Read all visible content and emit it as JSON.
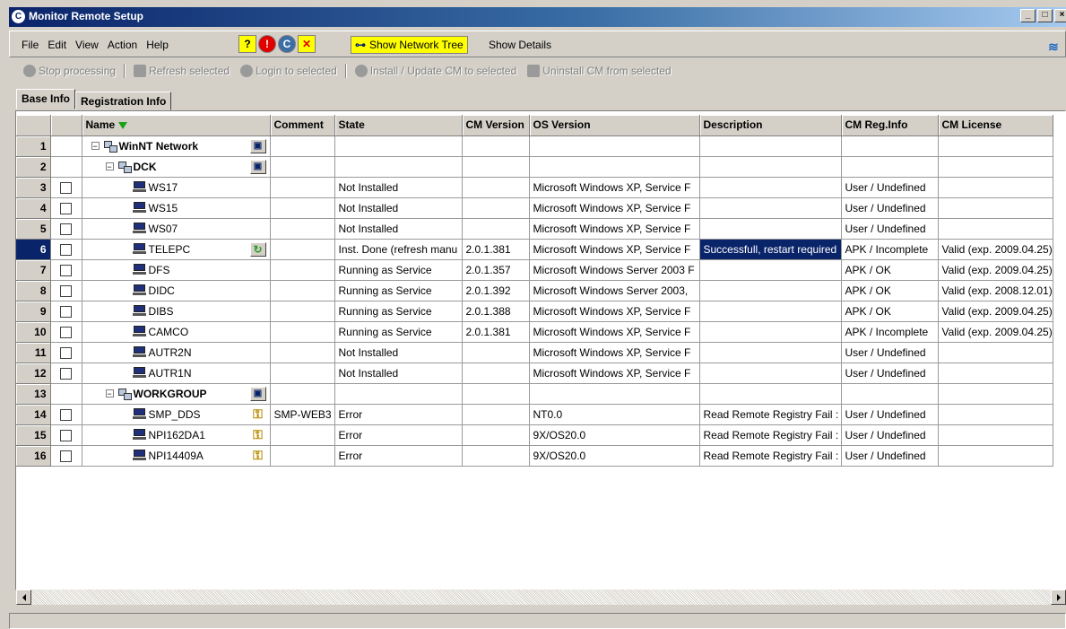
{
  "window": {
    "title": "Monitor Remote Setup",
    "app_icon_letter": "C",
    "controls": [
      "_",
      "□",
      "×"
    ]
  },
  "menu": {
    "items": [
      "File",
      "Edit",
      "View",
      "Action",
      "Help"
    ],
    "icon_buttons": [
      {
        "name": "help-icon",
        "glyph": "?"
      },
      {
        "name": "alert-icon",
        "glyph": "!"
      },
      {
        "name": "cm-icon",
        "glyph": "C"
      },
      {
        "name": "disconnect-icon",
        "glyph": "✕"
      }
    ],
    "show_network_tree": "Show Network Tree",
    "show_details": "Show Details"
  },
  "actions": [
    {
      "name": "stop-processing",
      "label": "Stop processing"
    },
    {
      "name": "refresh-selected",
      "label": "Refresh selected"
    },
    {
      "name": "login-to-selected",
      "label": "Login to selected"
    },
    {
      "name": "install-update-cm",
      "label": "Install / Update CM to selected"
    },
    {
      "name": "uninstall-cm",
      "label": "Uninstall CM from selected"
    }
  ],
  "tabs": [
    {
      "label": "Base Info",
      "active": true
    },
    {
      "label": "Registration Info",
      "active": false
    }
  ],
  "columns": {
    "name": "Name",
    "comment": "Comment",
    "state": "State",
    "cm_version": "CM Version",
    "os_version": "OS Version",
    "description": "Description",
    "cm_reg_info": "CM Reg.Info",
    "cm_license": "CM License"
  },
  "rows": [
    {
      "num": "1",
      "level": 0,
      "type": "network",
      "name": "WinNT Network",
      "bold": true,
      "check": false,
      "side": "monitor",
      "comment": "",
      "state": "",
      "cm_version": "",
      "os_version": "",
      "description": "",
      "cm_reg_info": "",
      "cm_license": ""
    },
    {
      "num": "2",
      "level": 1,
      "type": "network",
      "name": "DCK",
      "bold": true,
      "check": false,
      "side": "monitor",
      "comment": "",
      "state": "",
      "cm_version": "",
      "os_version": "",
      "description": "",
      "cm_reg_info": "",
      "cm_license": ""
    },
    {
      "num": "3",
      "level": 2,
      "type": "pc",
      "name": "WS17",
      "check": true,
      "side": "",
      "comment": "",
      "state": "Not Installed",
      "cm_version": "",
      "os_version": "Microsoft Windows XP, Service F",
      "description": "",
      "cm_reg_info": "User / Undefined",
      "cm_license": ""
    },
    {
      "num": "4",
      "level": 2,
      "type": "pc",
      "name": "WS15",
      "check": true,
      "side": "",
      "comment": "",
      "state": "Not Installed",
      "cm_version": "",
      "os_version": "Microsoft Windows XP, Service F",
      "description": "",
      "cm_reg_info": "User / Undefined",
      "cm_license": ""
    },
    {
      "num": "5",
      "level": 2,
      "type": "pc",
      "name": "WS07",
      "check": true,
      "side": "",
      "comment": "",
      "state": "Not Installed",
      "cm_version": "",
      "os_version": "Microsoft Windows XP, Service F",
      "description": "",
      "cm_reg_info": "User / Undefined",
      "cm_license": ""
    },
    {
      "num": "6",
      "level": 2,
      "type": "pc",
      "name": "TELEPC",
      "check": true,
      "side": "refresh",
      "selected": true,
      "comment": "",
      "state": "Inst. Done (refresh manu",
      "cm_version": "2.0.1.381",
      "os_version": "Microsoft Windows XP, Service F",
      "description": "Successfull, restart required",
      "desc_highlight": true,
      "cm_reg_info": "APK / Incomplete",
      "cm_license": "Valid (exp. 2009.04.25)"
    },
    {
      "num": "7",
      "level": 2,
      "type": "pc",
      "name": "DFS",
      "check": true,
      "side": "",
      "comment": "",
      "state": "Running as Service",
      "cm_version": "2.0.1.357",
      "os_version": "Microsoft Windows Server 2003 F",
      "description": "",
      "cm_reg_info": "APK / OK",
      "cm_license": "Valid (exp. 2009.04.25)"
    },
    {
      "num": "8",
      "level": 2,
      "type": "pc",
      "name": "DIDC",
      "check": true,
      "side": "",
      "comment": "",
      "state": "Running as Service",
      "cm_version": "2.0.1.392",
      "os_version": "Microsoft Windows Server 2003,",
      "description": "",
      "cm_reg_info": "APK / OK",
      "cm_license": "Valid (exp. 2008.12.01)"
    },
    {
      "num": "9",
      "level": 2,
      "type": "pc",
      "name": "DIBS",
      "check": true,
      "side": "",
      "comment": "",
      "state": "Running as Service",
      "cm_version": "2.0.1.388",
      "os_version": "Microsoft Windows XP, Service F",
      "description": "",
      "cm_reg_info": "APK / OK",
      "cm_license": "Valid (exp. 2009.04.25)"
    },
    {
      "num": "10",
      "level": 2,
      "type": "pc",
      "name": "CAMCO",
      "check": true,
      "side": "",
      "comment": "",
      "state": "Running as Service",
      "cm_version": "2.0.1.381",
      "os_version": "Microsoft Windows XP, Service F",
      "description": "",
      "cm_reg_info": "APK / Incomplete",
      "cm_license": "Valid (exp. 2009.04.25)"
    },
    {
      "num": "11",
      "level": 2,
      "type": "pc",
      "name": "AUTR2N",
      "check": true,
      "side": "",
      "comment": "",
      "state": "Not Installed",
      "cm_version": "",
      "os_version": "Microsoft Windows XP, Service F",
      "description": "",
      "cm_reg_info": "User / Undefined",
      "cm_license": ""
    },
    {
      "num": "12",
      "level": 2,
      "type": "pc",
      "name": "AUTR1N",
      "check": true,
      "side": "",
      "comment": "",
      "state": "Not Installed",
      "cm_version": "",
      "os_version": "Microsoft Windows XP, Service F",
      "description": "",
      "cm_reg_info": "User / Undefined",
      "cm_license": ""
    },
    {
      "num": "13",
      "level": 1,
      "type": "network",
      "name": "WORKGROUP",
      "bold": true,
      "check": false,
      "side": "monitor",
      "comment": "",
      "state": "",
      "cm_version": "",
      "os_version": "",
      "description": "",
      "cm_reg_info": "",
      "cm_license": ""
    },
    {
      "num": "14",
      "level": 2,
      "type": "pc",
      "name": "SMP_DDS",
      "check": true,
      "side": "key",
      "comment": "SMP-WEB3",
      "state": "Error",
      "cm_version": "",
      "os_version": "NT0.0",
      "description": "Read Remote Registry Fail :",
      "cm_reg_info": "User / Undefined",
      "cm_license": ""
    },
    {
      "num": "15",
      "level": 2,
      "type": "pc",
      "name": "NPI162DA1",
      "check": true,
      "side": "key",
      "comment": "",
      "state": "Error",
      "cm_version": "",
      "os_version": "9X/OS20.0",
      "description": "Read Remote Registry Fail :",
      "cm_reg_info": "User / Undefined",
      "cm_license": ""
    },
    {
      "num": "16",
      "level": 2,
      "type": "pc",
      "name": "NPI14409A",
      "check": true,
      "side": "key",
      "comment": "",
      "state": "Error",
      "cm_version": "",
      "os_version": "9X/OS20.0",
      "description": "Read Remote Registry Fail :",
      "cm_reg_info": "User / Undefined",
      "cm_license": ""
    }
  ],
  "colors": {
    "titlebar_start": "#0a246a",
    "selection": "#0a246a",
    "toolbar_highlight": "#ffff00"
  }
}
